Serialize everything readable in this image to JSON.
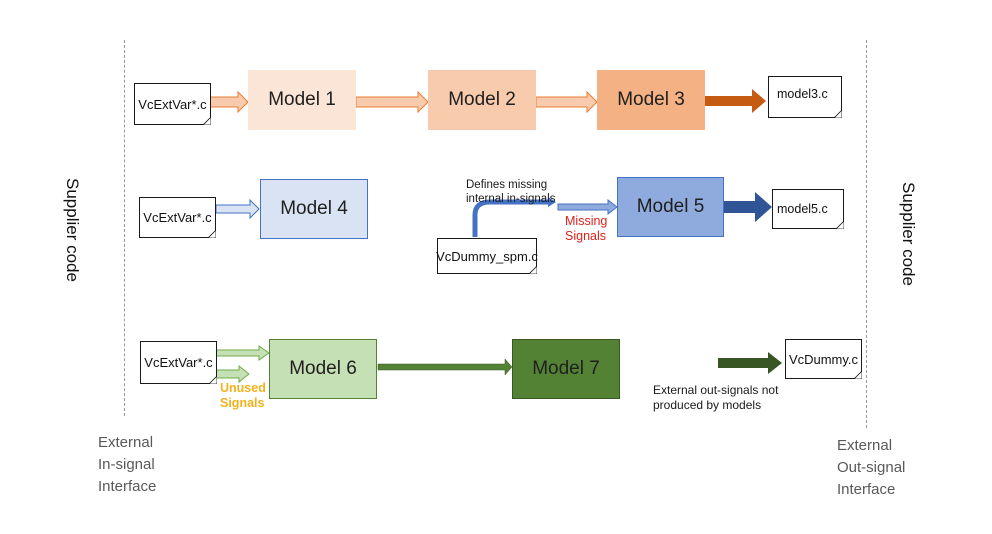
{
  "diagram": {
    "left_boundary": {
      "vertical_label": "Supplier code",
      "interface_label": [
        "External",
        "In-signal",
        "Interface"
      ]
    },
    "right_boundary": {
      "vertical_label": "Supplier code",
      "interface_label": [
        "External",
        "Out-signal",
        "Interface"
      ]
    },
    "row1": {
      "input_file": "VcExtVar*.c",
      "models": [
        "Model 1",
        "Model 2",
        "Model 3"
      ],
      "output_file": "model3.c"
    },
    "row2": {
      "input_file": "VcExtVar*.c",
      "model_a": "Model 4",
      "dummy_file": "VcDummy_spm.c",
      "dummy_note": [
        "Defines missing",
        "internal in-signals"
      ],
      "missing_label": [
        "Missing",
        "Signals"
      ],
      "model_b": "Model 5",
      "output_file": "model5.c"
    },
    "row3": {
      "input_file": "VcExtVar*.c",
      "unused_label": [
        "Unused",
        "Signals"
      ],
      "models": [
        "Model 6",
        "Model 7"
      ],
      "output_file": "VcDummy.c",
      "output_note": [
        "External out-signals not",
        "produced by models"
      ]
    },
    "colors": {
      "model1": "#fbe5d6",
      "model2": "#f8cbad",
      "model3": "#f4b183",
      "orange_arrow_dark": "#c55a11",
      "model4": "#dae3f3",
      "model5": "#8faadc",
      "blue_arrow_dark": "#2f5597",
      "model6": "#c5e0b4",
      "model7": "#548235",
      "green_arrow_dark": "#375623",
      "missing_text": "#e0201b",
      "unused_text": "#f2b21d"
    }
  }
}
